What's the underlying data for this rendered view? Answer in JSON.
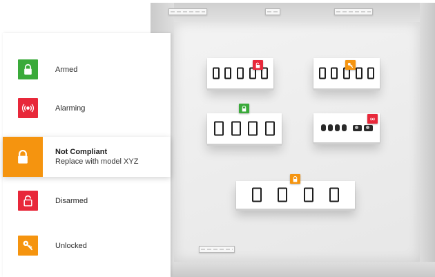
{
  "colors": {
    "armed": "#3aaa3a",
    "alarming": "#e8283a",
    "not_compliant": "#f5940f",
    "disarmed": "#e8283a",
    "unlocked": "#f5940f"
  },
  "legend": {
    "items": [
      {
        "key": "armed",
        "label": "Armed",
        "icon": "lock-closed-icon"
      },
      {
        "key": "alarming",
        "label": "Alarming",
        "icon": "alarm-signal-icon"
      },
      {
        "key": "not_compliant",
        "label": "Not Compliant",
        "sublabel": "Replace with model XYZ",
        "icon": "lock-closed-icon",
        "selected": true
      },
      {
        "key": "disarmed",
        "label": "Disarmed",
        "icon": "lock-open-icon"
      },
      {
        "key": "unlocked",
        "label": "Unlocked",
        "icon": "key-icon"
      }
    ]
  },
  "floor_plan": {
    "tables": [
      {
        "name": "table-top-left",
        "devices": [
          "phone",
          "phone",
          "phone",
          "phone",
          "phone"
        ],
        "status": "disarmed"
      },
      {
        "name": "table-top-right",
        "devices": [
          "phone",
          "phone",
          "phone",
          "phone",
          "phone"
        ],
        "status": "unlocked"
      },
      {
        "name": "table-middle-left",
        "devices": [
          "tablet",
          "tablet",
          "tablet",
          "tablet"
        ],
        "status": "armed"
      },
      {
        "name": "table-middle-right",
        "devices": [
          "watch",
          "watch",
          "watch",
          "watch",
          "camera",
          "camera"
        ],
        "status": "alarming"
      },
      {
        "name": "table-bottom",
        "devices": [
          "tablet",
          "tablet",
          "tablet",
          "tablet"
        ],
        "status": "not_compliant"
      }
    ]
  }
}
